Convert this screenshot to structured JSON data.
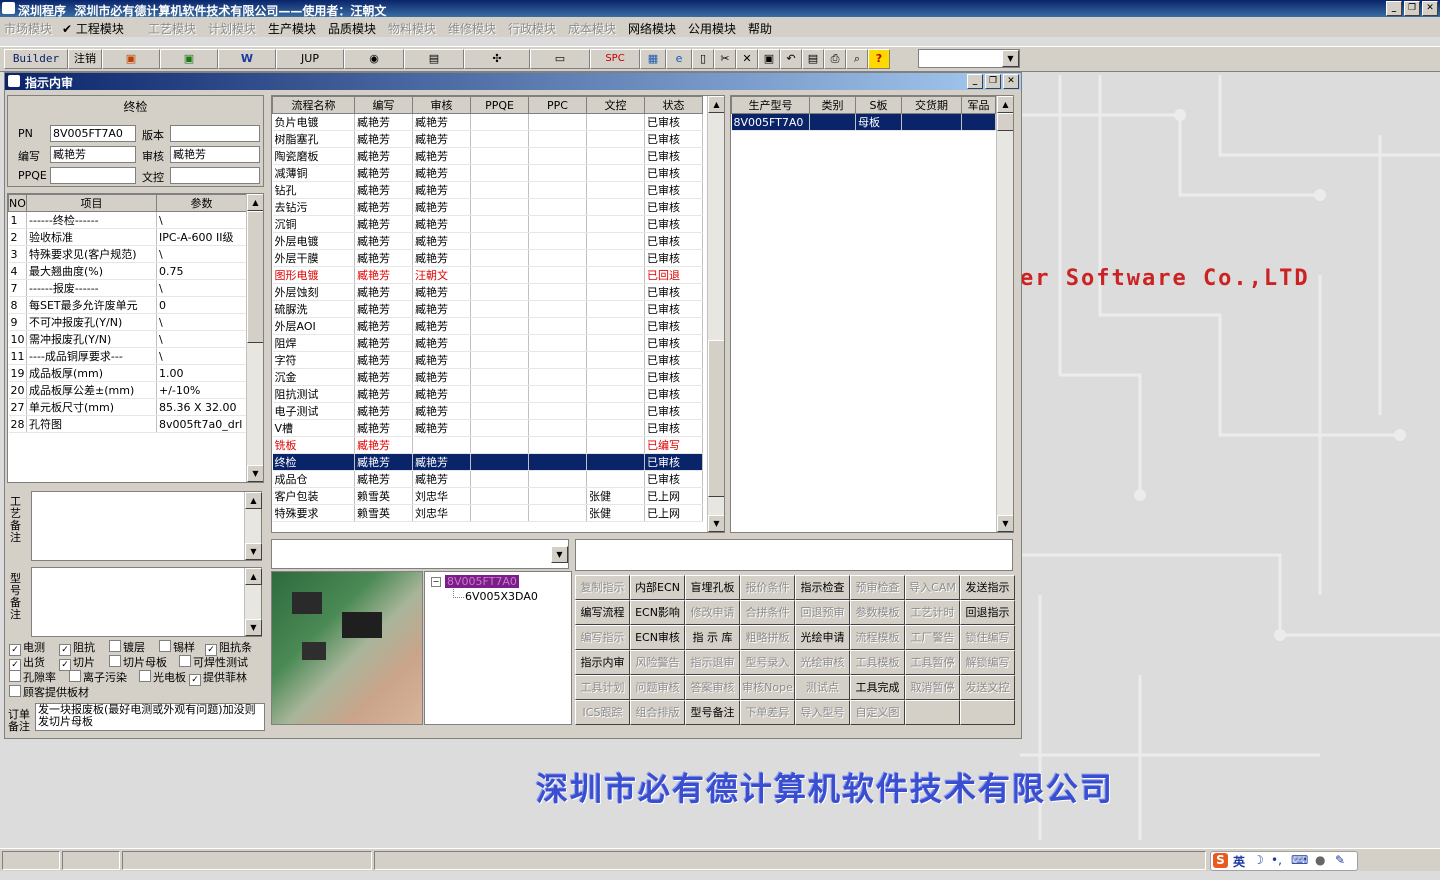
{
  "window": {
    "title": "深圳程序  深圳市必有德计算机软件技术有限公司——使用者：汪朝文"
  },
  "menu": [
    {
      "label": "市场模块",
      "disabled": true
    },
    {
      "label": "✔ 工程模块",
      "disabled": false
    },
    {
      "label": "工艺模块",
      "disabled": true
    },
    {
      "label": "计划模块",
      "disabled": true
    },
    {
      "label": "生产模块",
      "disabled": false
    },
    {
      "label": "品质模块",
      "disabled": false
    },
    {
      "label": "物料模块",
      "disabled": true
    },
    {
      "label": "维修模块",
      "disabled": true
    },
    {
      "label": "行政模块",
      "disabled": true
    },
    {
      "label": "成本模块",
      "disabled": true
    },
    {
      "label": "网络模块",
      "disabled": false
    },
    {
      "label": "公用模块",
      "disabled": false
    },
    {
      "label": "帮助",
      "disabled": false
    }
  ],
  "toolbar": {
    "builder": "Builder",
    "logout": "注销",
    "jup": "JUP",
    "spc": "SPC"
  },
  "background": {
    "en": "er Software Co.,LTD",
    "cn": "深圳市必有德计算机软件技术有限公司"
  },
  "form": {
    "title": "指示内审",
    "header_label": "终检",
    "pn_label": "PN",
    "pn_value": "8V005FT7A0",
    "version_label": "版本",
    "version_value": "",
    "author_label": "编写",
    "author_value": "臧艳芳",
    "review_label": "审核",
    "review_value": "臧艳芳",
    "ppqe_label": "PPQE",
    "ppqe_value": "",
    "doc_label": "文控",
    "doc_value": ""
  },
  "params": {
    "headers": [
      "NO",
      "项目",
      "参数"
    ],
    "rows": [
      [
        "1",
        "------终检------",
        "\\"
      ],
      [
        "2",
        "验收标准",
        "IPC-A-600 II级"
      ],
      [
        "3",
        "特殊要求见(客户规范)",
        "\\"
      ],
      [
        "4",
        "最大翘曲度(%)",
        "0.75"
      ],
      [
        "7",
        "------报废------",
        "\\"
      ],
      [
        "8",
        "每SET最多允许废单元",
        "0"
      ],
      [
        "9",
        "不可冲报废孔(Y/N)",
        "\\"
      ],
      [
        "10",
        "需冲报废孔(Y/N)",
        "\\"
      ],
      [
        "11",
        "----成品铜厚要求---",
        "\\"
      ],
      [
        "19",
        "成品板厚(mm)",
        "1.00"
      ],
      [
        "20",
        "成品板厚公差±(mm)",
        "+/-10%"
      ],
      [
        "27",
        "单元板尺寸(mm)",
        "85.36 X 32.00"
      ],
      [
        "28",
        "孔符图",
        "8v005ft7a0_drl"
      ]
    ]
  },
  "notes": {
    "process_label": "工艺备注",
    "model_label": "型号备注",
    "order_label": "订单备注",
    "order_text": "发一块报废板(最好电测或外观有问题)加没则发切片母板"
  },
  "checkboxes": [
    {
      "label": "电测",
      "checked": true
    },
    {
      "label": "阻抗",
      "checked": true
    },
    {
      "label": "镀层",
      "checked": false
    },
    {
      "label": "锡样",
      "checked": false
    },
    {
      "label": "阻抗条",
      "checked": true
    },
    {
      "label": "出货",
      "checked": true
    },
    {
      "label": "切片",
      "checked": true
    },
    {
      "label": "切片母板",
      "checked": false
    },
    {
      "label": "可焊性测试",
      "checked": false
    },
    {
      "label": "孔隙率",
      "checked": false
    },
    {
      "label": "离子污染",
      "checked": false
    },
    {
      "label": "光电板",
      "checked": false
    },
    {
      "label": "提供菲林",
      "checked": true
    },
    {
      "label": "顾客提供板材",
      "checked": false
    }
  ],
  "flow": {
    "headers": [
      "流程名称",
      "编写",
      "审核",
      "PPQE",
      "PPC",
      "文控",
      "状态"
    ],
    "rows": [
      {
        "c": [
          "负片电镀",
          "臧艳芳",
          "臧艳芳",
          "",
          "",
          "",
          "已审核"
        ]
      },
      {
        "c": [
          "树脂塞孔",
          "臧艳芳",
          "臧艳芳",
          "",
          "",
          "",
          "已审核"
        ]
      },
      {
        "c": [
          "陶瓷磨板",
          "臧艳芳",
          "臧艳芳",
          "",
          "",
          "",
          "已审核"
        ]
      },
      {
        "c": [
          "减薄铜",
          "臧艳芳",
          "臧艳芳",
          "",
          "",
          "",
          "已审核"
        ]
      },
      {
        "c": [
          "钻孔",
          "臧艳芳",
          "臧艳芳",
          "",
          "",
          "",
          "已审核"
        ]
      },
      {
        "c": [
          "去钻污",
          "臧艳芳",
          "臧艳芳",
          "",
          "",
          "",
          "已审核"
        ]
      },
      {
        "c": [
          "沉铜",
          "臧艳芳",
          "臧艳芳",
          "",
          "",
          "",
          "已审核"
        ]
      },
      {
        "c": [
          "外层电镀",
          "臧艳芳",
          "臧艳芳",
          "",
          "",
          "",
          "已审核"
        ]
      },
      {
        "c": [
          "外层干膜",
          "臧艳芳",
          "臧艳芳",
          "",
          "",
          "",
          "已审核"
        ]
      },
      {
        "c": [
          "图形电镀",
          "臧艳芳",
          "汪朝文",
          "",
          "",
          "",
          "已回退"
        ],
        "red": true
      },
      {
        "c": [
          "外层蚀刻",
          "臧艳芳",
          "臧艳芳",
          "",
          "",
          "",
          "已审核"
        ]
      },
      {
        "c": [
          "硫脲洗",
          "臧艳芳",
          "臧艳芳",
          "",
          "",
          "",
          "已审核"
        ]
      },
      {
        "c": [
          "外层AOI",
          "臧艳芳",
          "臧艳芳",
          "",
          "",
          "",
          "已审核"
        ]
      },
      {
        "c": [
          "阻焊",
          "臧艳芳",
          "臧艳芳",
          "",
          "",
          "",
          "已审核"
        ]
      },
      {
        "c": [
          "字符",
          "臧艳芳",
          "臧艳芳",
          "",
          "",
          "",
          "已审核"
        ]
      },
      {
        "c": [
          "沉金",
          "臧艳芳",
          "臧艳芳",
          "",
          "",
          "",
          "已审核"
        ]
      },
      {
        "c": [
          "阻抗测试",
          "臧艳芳",
          "臧艳芳",
          "",
          "",
          "",
          "已审核"
        ]
      },
      {
        "c": [
          "电子测试",
          "臧艳芳",
          "臧艳芳",
          "",
          "",
          "",
          "已审核"
        ]
      },
      {
        "c": [
          "V槽",
          "臧艳芳",
          "臧艳芳",
          "",
          "",
          "",
          "已审核"
        ]
      },
      {
        "c": [
          "铣板",
          "臧艳芳",
          "",
          "",
          "",
          "",
          "已编写"
        ],
        "red": true
      },
      {
        "c": [
          "终检",
          "臧艳芳",
          "臧艳芳",
          "",
          "",
          "",
          "已审核"
        ],
        "sel": true
      },
      {
        "c": [
          "成品仓",
          "臧艳芳",
          "臧艳芳",
          "",
          "",
          "",
          "已审核"
        ]
      },
      {
        "c": [
          "客户包装",
          "赖雪英",
          "刘忠华",
          "",
          "",
          "张健",
          "已上网"
        ]
      },
      {
        "c": [
          "特殊要求",
          "赖雪英",
          "刘忠华",
          "",
          "",
          "张健",
          "已上网"
        ]
      }
    ]
  },
  "models": {
    "headers": [
      "生产型号",
      "类别",
      "S板",
      "交货期",
      "军品"
    ],
    "rows": [
      [
        "8V005FT7A0",
        "",
        "母板",
        "",
        ""
      ]
    ]
  },
  "tree": {
    "root": "8V005FT7A0",
    "child": "6V005X3DA0"
  },
  "commands": [
    [
      {
        "l": "复制指示",
        "d": true
      },
      {
        "l": "内部ECN",
        "d": false
      },
      {
        "l": "盲埋孔板",
        "d": false
      },
      {
        "l": "报价条件",
        "d": true
      },
      {
        "l": "指示检查",
        "d": false
      },
      {
        "l": "预审检查",
        "d": true
      },
      {
        "l": "导入CAM",
        "d": true
      },
      {
        "l": "发送指示",
        "d": false
      }
    ],
    [
      {
        "l": "编写流程",
        "d": false
      },
      {
        "l": "ECN影响",
        "d": false
      },
      {
        "l": "修改申请",
        "d": true
      },
      {
        "l": "合拼条件",
        "d": true
      },
      {
        "l": "回退预审",
        "d": true
      },
      {
        "l": "参数模板",
        "d": true
      },
      {
        "l": "工艺计时",
        "d": true
      },
      {
        "l": "回退指示",
        "d": false
      }
    ],
    [
      {
        "l": "编写指示",
        "d": true
      },
      {
        "l": "ECN审核",
        "d": false
      },
      {
        "l": "指 示 库",
        "d": false
      },
      {
        "l": "粗略拼板",
        "d": true
      },
      {
        "l": "光绘申请",
        "d": false
      },
      {
        "l": "流程模板",
        "d": true
      },
      {
        "l": "工厂警告",
        "d": true
      },
      {
        "l": "锁住编写",
        "d": true
      }
    ],
    [
      {
        "l": "指示内审",
        "d": false
      },
      {
        "l": "风险警告",
        "d": true
      },
      {
        "l": "指示退审",
        "d": true
      },
      {
        "l": "型号录入",
        "d": true
      },
      {
        "l": "光绘审核",
        "d": true
      },
      {
        "l": "工具模板",
        "d": true
      },
      {
        "l": "工具暂停",
        "d": true
      },
      {
        "l": "解锁编写",
        "d": true
      }
    ],
    [
      {
        "l": "工具计划",
        "d": true
      },
      {
        "l": "问题审核",
        "d": true
      },
      {
        "l": "答案审核",
        "d": true
      },
      {
        "l": "审核Nope",
        "d": true
      },
      {
        "l": "测试点",
        "d": true
      },
      {
        "l": "工具完成",
        "d": false
      },
      {
        "l": "取消暂停",
        "d": true
      },
      {
        "l": "发送文控",
        "d": true
      }
    ],
    [
      {
        "l": "ICS跟踪",
        "d": true
      },
      {
        "l": "组合排版",
        "d": true
      },
      {
        "l": "型号备注",
        "d": false
      },
      {
        "l": "下单差异",
        "d": true
      },
      {
        "l": "导入型号",
        "d": true
      },
      {
        "l": "自定义图",
        "d": true
      },
      {
        "l": "",
        "d": true
      },
      {
        "l": "",
        "d": true
      }
    ]
  ],
  "tray": {
    "ime": "英"
  }
}
